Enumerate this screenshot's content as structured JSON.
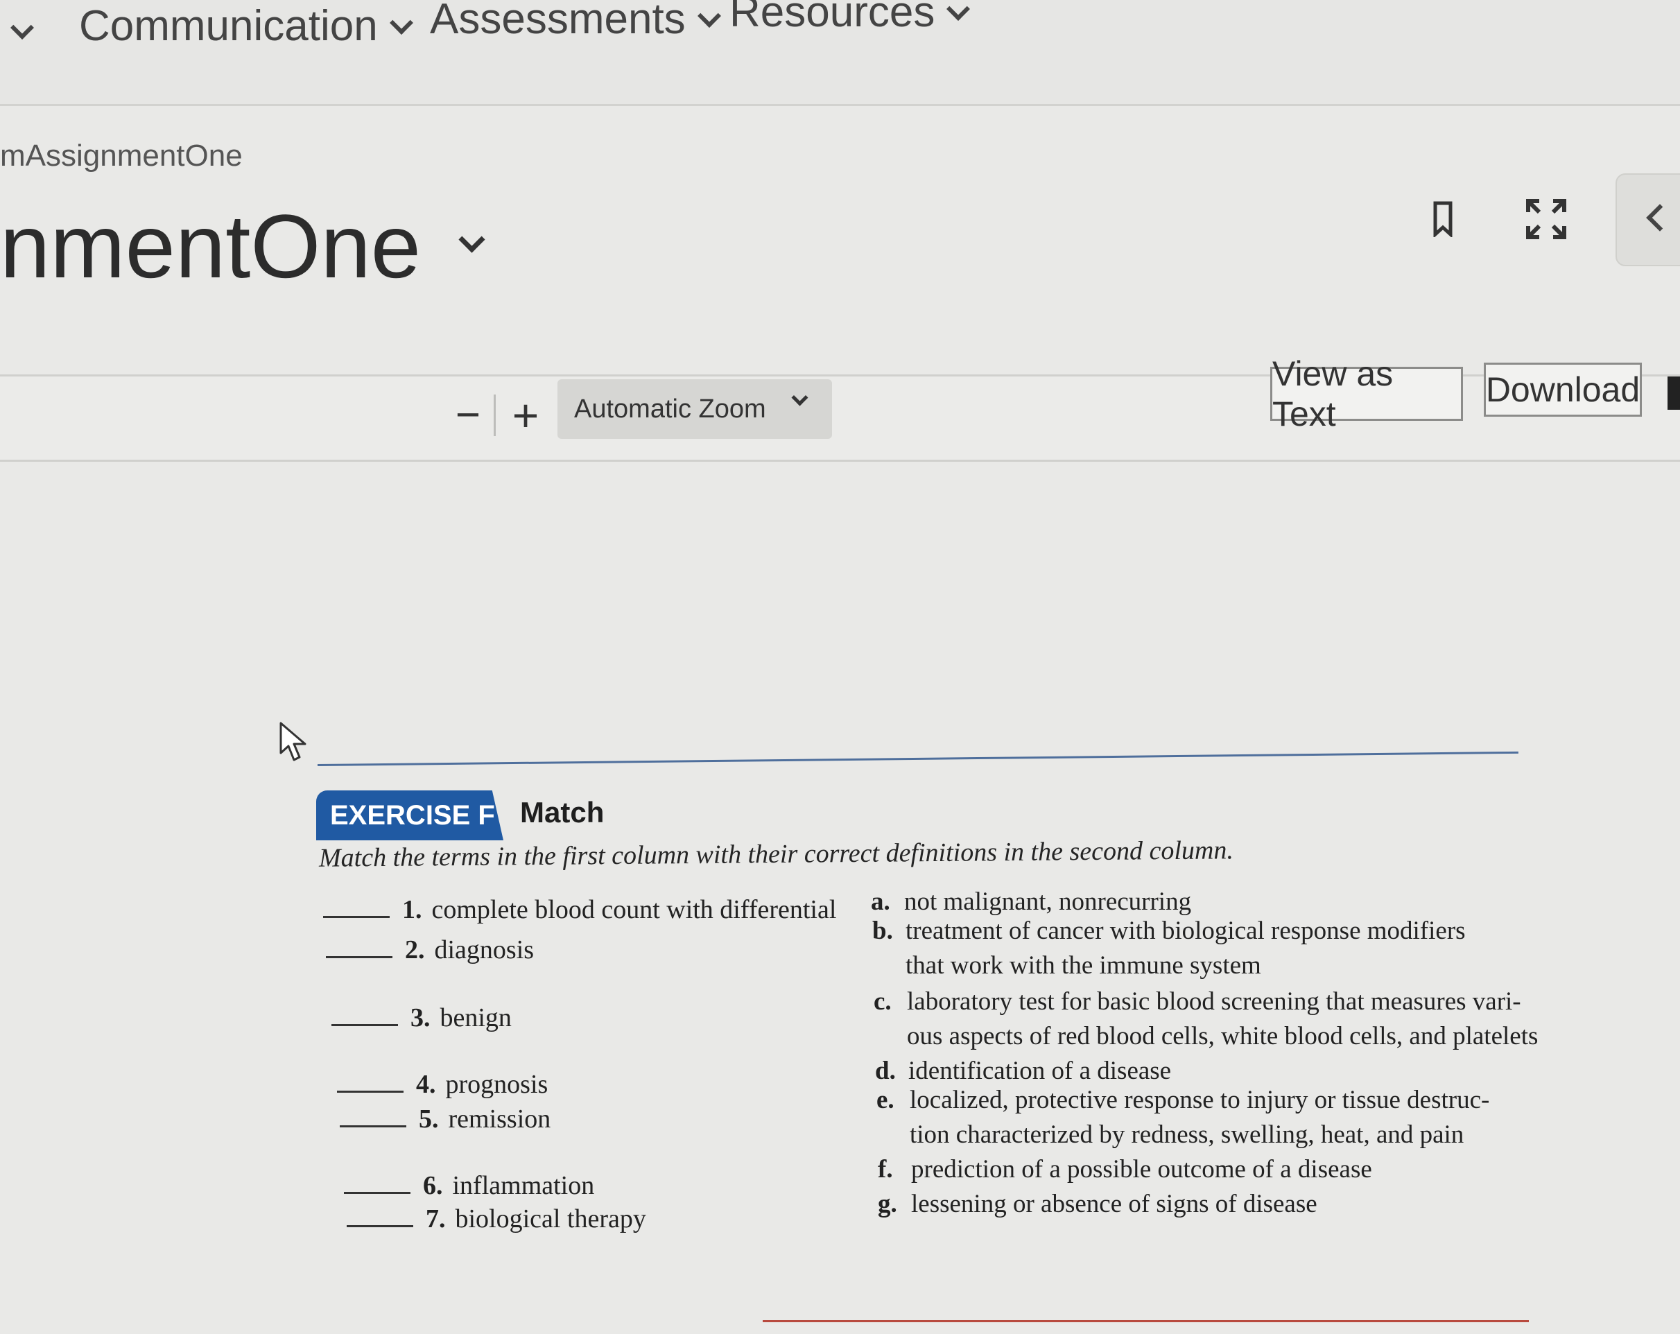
{
  "nav": {
    "items": [
      {
        "label": "Communication"
      },
      {
        "label": "Assessments"
      },
      {
        "label": "Resources"
      }
    ]
  },
  "breadcrumb": "mAssignmentOne",
  "page_title": "nmentOne",
  "icons": {
    "bookmark": "bookmark-icon",
    "expand": "expand-icon",
    "collapse": "chevron-left-icon"
  },
  "toolbar": {
    "zoom_out": "−",
    "zoom_in": "+",
    "zoom_select": "Automatic Zoom",
    "view_as_text": "View as Text",
    "download": "Download"
  },
  "exercise": {
    "tab": "EXERCISE F",
    "label": "Match",
    "instructions": "Match the terms in the first column with their correct definitions in the second column.",
    "terms": [
      {
        "num": "1.",
        "text": "complete blood count with differential"
      },
      {
        "num": "2.",
        "text": "diagnosis"
      },
      {
        "num": "3.",
        "text": "benign"
      },
      {
        "num": "4.",
        "text": "prognosis"
      },
      {
        "num": "5.",
        "text": "remission"
      },
      {
        "num": "6.",
        "text": "inflammation"
      },
      {
        "num": "7.",
        "text": "biological therapy"
      }
    ],
    "definitions": [
      {
        "letter": "a.",
        "lines": [
          "not malignant, nonrecurring"
        ]
      },
      {
        "letter": "b.",
        "lines": [
          "treatment of cancer with biological response modifiers",
          "that work with the immune system"
        ]
      },
      {
        "letter": "c.",
        "lines": [
          "laboratory test for basic blood screening that measures vari-",
          "ous aspects of red blood cells, white blood cells, and platelets"
        ]
      },
      {
        "letter": "d.",
        "lines": [
          "identification of a disease"
        ]
      },
      {
        "letter": "e.",
        "lines": [
          "localized, protective response to injury or tissue destruc-",
          "tion characterized by redness, swelling, heat, and pain"
        ]
      },
      {
        "letter": "f.",
        "lines": [
          "prediction of a possible outcome of a disease"
        ]
      },
      {
        "letter": "g.",
        "lines": [
          "lessening or absence of signs of disease"
        ]
      }
    ]
  }
}
